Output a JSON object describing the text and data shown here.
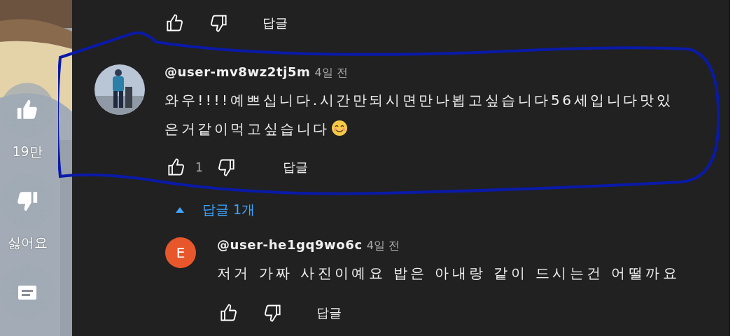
{
  "side_actions": [
    {
      "kind": "like",
      "label": "19만"
    },
    {
      "kind": "dislike",
      "label": "싫어요"
    },
    {
      "kind": "comments"
    }
  ],
  "previous_comment": {
    "reply_label": "답글"
  },
  "comment": {
    "author": "@user-mv8wz2tj5m",
    "time": "4일 전",
    "text": "와우!!!!예쁘십니다.시간만되시면만나뵙고싶습니다56세입니다맛있은거같이먹고싶습니다",
    "ends_with_smiley": true,
    "likes": "1",
    "reply_label": "답글",
    "circled": true,
    "replies_toggle": {
      "label": "답글 1개",
      "expanded": true
    },
    "replies": [
      {
        "author": "@user-he1gq9wo6c",
        "time": "4일 전",
        "avatar_letter": "E",
        "color": "#e8572b",
        "text": "저거 가짜 사진이예요 밥은 아내랑 같이 드시는건 어떨까요",
        "reply_label": "답글"
      }
    ]
  }
}
